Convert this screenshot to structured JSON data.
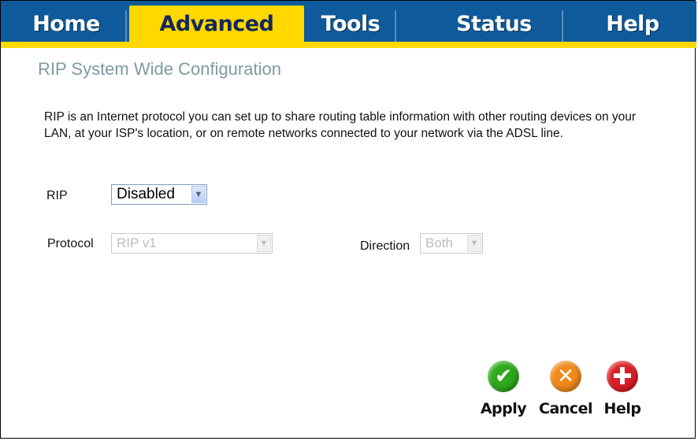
{
  "nav": {
    "tabs": [
      {
        "label": "Home"
      },
      {
        "label": "Advanced"
      },
      {
        "label": "Tools"
      },
      {
        "label": "Status"
      },
      {
        "label": "Help"
      }
    ],
    "active": "Advanced"
  },
  "main": {
    "title": "RIP System Wide Configuration",
    "description": "RIP is an Internet protocol you can set up to share routing table information with other routing devices on your LAN, at your ISP's location, or on remote networks connected to your network via the ADSL line.",
    "rip": {
      "label": "RIP",
      "value": "Disabled"
    },
    "protocol": {
      "label": "Protocol",
      "value": "RIP v1"
    },
    "direction": {
      "label": "Direction",
      "value": "Both"
    }
  },
  "actions": {
    "apply": "Apply",
    "cancel": "Cancel",
    "help": "Help"
  },
  "colors": {
    "nav_bg": "#0f5a9a",
    "active_tab": "#ffd800",
    "title": "#7d9aa3",
    "apply": "#2fa81d",
    "cancel": "#f08a1b",
    "help": "#d91f25"
  },
  "icons": {
    "apply": "check-icon",
    "cancel": "x-icon",
    "help": "plus-icon"
  }
}
